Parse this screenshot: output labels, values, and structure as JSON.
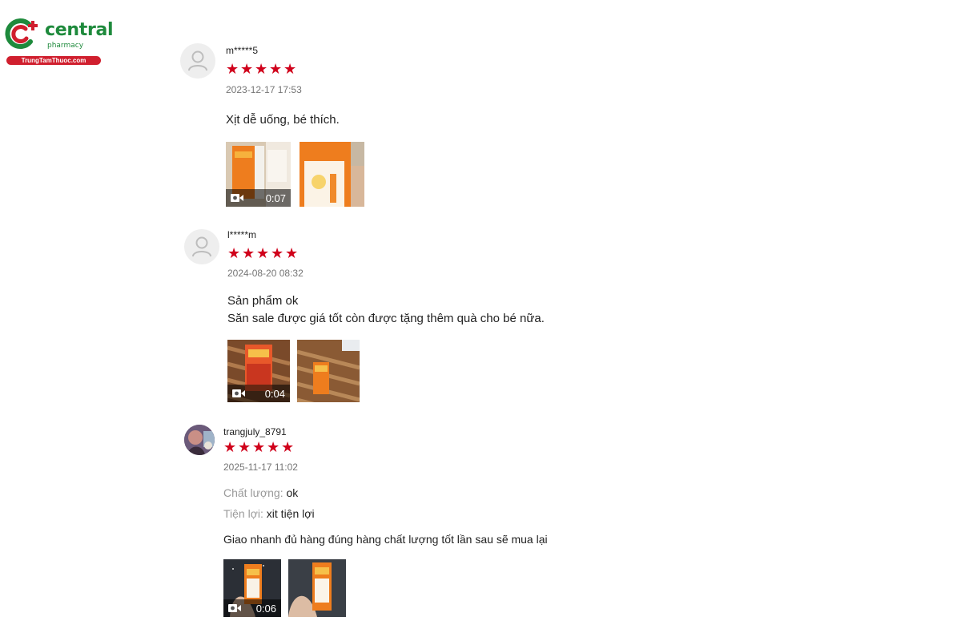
{
  "brand": {
    "name": "central",
    "sub": "pharmacy",
    "domain": "TrungTamThuoc.com",
    "colors": {
      "green": "#1e8a3c",
      "red": "#d01f2e"
    }
  },
  "star_color": "#d0011b",
  "reviews": [
    {
      "username": "m*****5",
      "rating": 5,
      "date": "2023-12-17 17:53",
      "comment_lines": [
        "Xịt dễ uống, bé thích."
      ],
      "attributes": [],
      "media": [
        {
          "type": "video",
          "duration": "0:07"
        },
        {
          "type": "image"
        }
      ]
    },
    {
      "username": "l*****m",
      "rating": 5,
      "date": "2024-08-20 08:32",
      "comment_lines": [
        "Sản phẩm ok",
        "Săn sale được giá tốt còn được tặng thêm quà cho bé nữa."
      ],
      "attributes": [],
      "media": [
        {
          "type": "video",
          "duration": "0:04"
        },
        {
          "type": "image"
        }
      ]
    },
    {
      "username": "trangjuly_8791",
      "rating": 5,
      "date": "2025-11-17 11:02",
      "attributes": [
        {
          "label": "Chất lượng:",
          "value": "ok"
        },
        {
          "label": "Tiện lợi:",
          "value": "xit tiện lợi"
        }
      ],
      "comment_lines": [
        "Giao nhanh đủ hàng đúng hàng chất lượng tốt lần sau sẽ mua lại"
      ],
      "media": [
        {
          "type": "video",
          "duration": "0:06"
        },
        {
          "type": "image"
        }
      ]
    }
  ]
}
